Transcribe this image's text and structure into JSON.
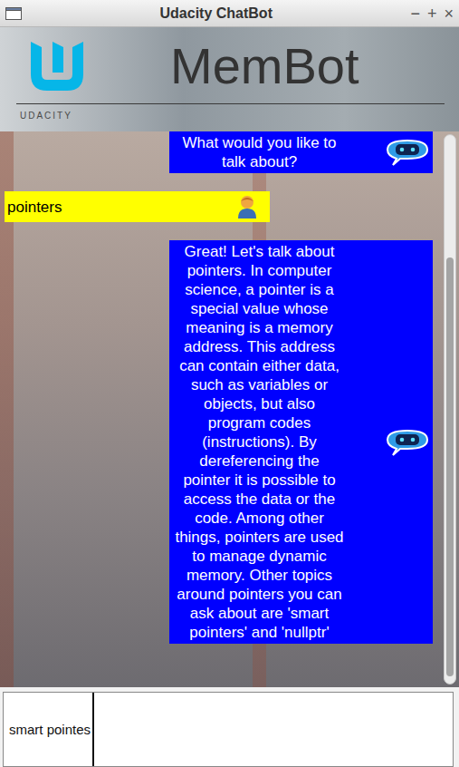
{
  "window": {
    "title": "Udacity ChatBot",
    "controls": [
      "−",
      "+",
      "×"
    ]
  },
  "header": {
    "title": "MemBot",
    "logo_caption": "UDACITY"
  },
  "messages": [
    {
      "sender": "bot",
      "text": "What would you like to talk about?"
    },
    {
      "sender": "user",
      "text": "pointers"
    },
    {
      "sender": "bot",
      "text": "Great! Let's talk about pointers. In computer science, a pointer is a special value whose meaning is a memory address. This address can contain either data, such as variables or objects, but also program codes (instructions). By dereferencing the pointer it is possible to access the data or the code. Among other things, pointers are used to manage dynamic memory. Other topics around pointers you can ask about are 'smart pointers' and 'nullptr'"
    }
  ],
  "scrollbar": {
    "thumb_share": 0.77,
    "position": 0.96
  },
  "input": {
    "value": "smart pointes",
    "focused": true
  }
}
